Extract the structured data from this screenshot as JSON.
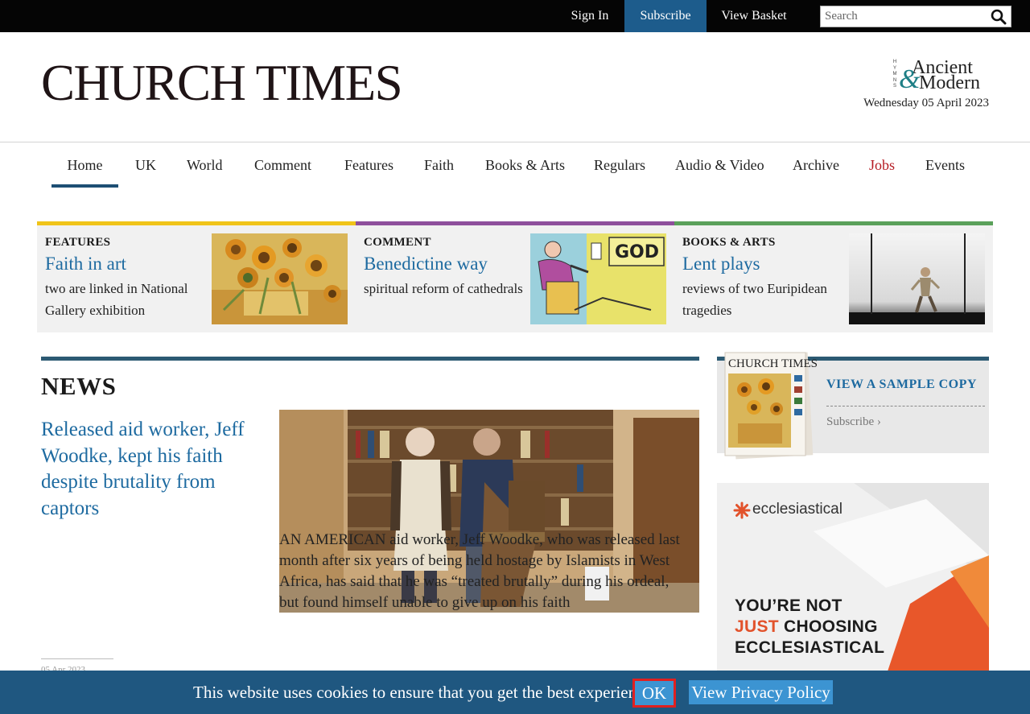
{
  "topbar": {
    "sign_in": "Sign In",
    "subscribe": "Subscribe",
    "view_basket": "View Basket",
    "search_placeholder": "Search"
  },
  "masthead": {
    "logo": "CHURCH TIMES",
    "partner_logo_small": "HYMNS",
    "partner_logo_amp": "&",
    "partner_logo_top": "Ancient",
    "partner_logo_bottom": "Modern",
    "date": "Wednesday 05 April 2023"
  },
  "nav": {
    "items": [
      {
        "label": "Home"
      },
      {
        "label": "UK"
      },
      {
        "label": "World"
      },
      {
        "label": "Comment"
      },
      {
        "label": "Features"
      },
      {
        "label": "Faith"
      },
      {
        "label": "Books & Arts"
      },
      {
        "label": "Regulars"
      },
      {
        "label": "Audio & Video"
      },
      {
        "label": "Archive"
      },
      {
        "label": "Jobs"
      },
      {
        "label": "Events"
      }
    ],
    "active": "Home"
  },
  "strip": [
    {
      "category": "FEATURES",
      "headline": "Faith in art",
      "dek": "two are linked in National Gallery exhibition",
      "color": "#f0c419",
      "image": "sunflowers-painting"
    },
    {
      "category": "COMMENT",
      "headline": "Benedictine way",
      "dek": "spiritual reform of cathedrals",
      "color": "#8e4f9c",
      "image": "god-cartoon"
    },
    {
      "category": "BOOKS & ARTS",
      "headline": "Lent plays",
      "dek": "reviews of two Euripidean tragedies",
      "color": "#5aa05a",
      "image": "stage-performer-photo"
    }
  ],
  "news": {
    "section_title": "NEWS",
    "headline": "Released aid worker, Jeff Woodke, kept his faith despite brutality from captors",
    "standfirst": "AN AMERICAN aid worker, Jeff Woodke, who was released last month after six years of being held hostage by Islamists in West Africa, has said that he was “treated brutally” during his ordeal, but found himself unable to give up on his faith",
    "date": "05 Apr 2023"
  },
  "sidebar": {
    "sample_logo": "CHURCH TIMES",
    "sample_link": "VIEW A SAMPLE COPY",
    "subscribe_link": "Subscribe",
    "ad": {
      "brand": "ecclesiastical",
      "line1": "YOU’RE NOT",
      "line2_accent": "JUST",
      "line2_rest": " CHOOSING",
      "line3": "ECCLESIASTICAL"
    }
  },
  "cookie": {
    "message": "This website uses cookies to ensure that you get the best experience",
    "ok": "OK",
    "privacy": "View Privacy Policy"
  },
  "colors": {
    "link_blue": "#1d6aa0",
    "topbar_bg": "#050505",
    "subscribe_bg": "#1d5c8c",
    "jobs_red": "#b51a22",
    "cookie_bg": "#1f5780",
    "button_blue": "#3c94d2"
  }
}
